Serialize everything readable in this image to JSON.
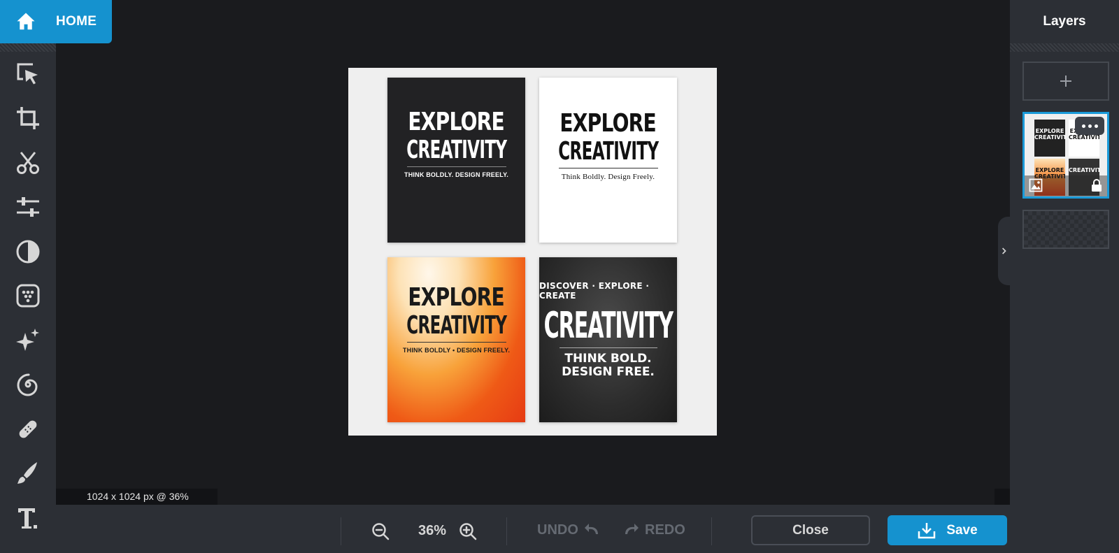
{
  "home": {
    "label": "HOME"
  },
  "toolbar": {
    "tools": [
      {
        "name": "select-icon",
        "icon": "select"
      },
      {
        "name": "crop-icon",
        "icon": "crop"
      },
      {
        "name": "cut-icon",
        "icon": "scissors"
      },
      {
        "name": "adjust-icon",
        "icon": "sliders"
      },
      {
        "name": "contrast-icon",
        "icon": "contrast"
      },
      {
        "name": "filter-icon",
        "icon": "dots-square"
      },
      {
        "name": "effects-icon",
        "icon": "sparkle"
      },
      {
        "name": "spiral-icon",
        "icon": "spiral"
      },
      {
        "name": "bandage-icon",
        "icon": "bandage"
      },
      {
        "name": "brush-icon",
        "icon": "brush"
      },
      {
        "name": "text-icon",
        "icon": "text"
      }
    ]
  },
  "canvas": {
    "dims_label": "1024 x 1024 px @ 36%",
    "posters": [
      {
        "title1": "EXPLORE",
        "title2": "CREATIVITY",
        "sub": "THINK BOLDLY. DESIGN FREELY."
      },
      {
        "title1": "EXPLORE",
        "title2": "CREATIVITY",
        "sub": "Think Boldly. Design Freely."
      },
      {
        "title1": "EXPLORE",
        "title2": "CREATIVITY",
        "sub": "THINK BOLDLY • DESIGN FREELY."
      },
      {
        "top": "DISCOVER · EXPLORE · CREATE",
        "big": "CREATIVITY",
        "line1": "THINK BOLD.",
        "line2": "DESIGN FREE."
      }
    ]
  },
  "bottom": {
    "zoom": "36%",
    "undo_label": "UNDO",
    "redo_label": "REDO",
    "close_label": "Close",
    "save_label": "Save"
  },
  "layers": {
    "title": "Layers",
    "thumb": {
      "m1_a": "EXPLORE",
      "m1_b": "CREATIVITY",
      "m2_a": "EXPLORE",
      "m2_b": "CREATIVITY",
      "m3_a": "EXPLORE",
      "m3_b": "CREATIVITY",
      "m4_a": "CREATIVITY"
    }
  },
  "colors": {
    "accent": "#1592cf",
    "toolbar": "#2c2f35",
    "canvas_bg": "#1a1b1e",
    "artboard": "#efefef"
  }
}
